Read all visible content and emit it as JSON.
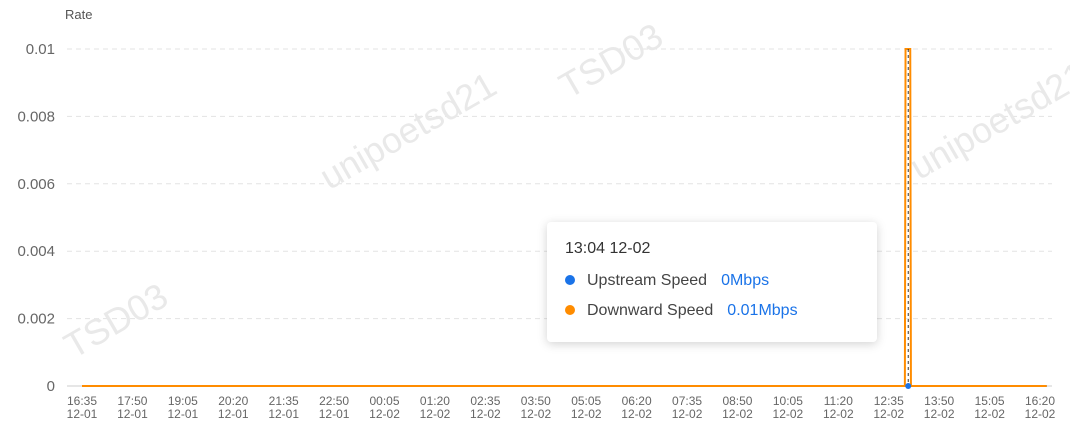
{
  "chart_data": {
    "type": "line",
    "ylabel": "Rate",
    "y_ticks": [
      "0.01",
      "0.008",
      "0.006",
      "0.004",
      "0.002",
      "0"
    ],
    "ylim": [
      0,
      0.01
    ],
    "grid": "horizontal-dashed",
    "x_labels": [
      {
        "time": "16:35",
        "date": "12-01"
      },
      {
        "time": "17:50",
        "date": "12-01"
      },
      {
        "time": "19:05",
        "date": "12-01"
      },
      {
        "time": "20:20",
        "date": "12-01"
      },
      {
        "time": "21:35",
        "date": "12-01"
      },
      {
        "time": "22:50",
        "date": "12-01"
      },
      {
        "time": "00:05",
        "date": "12-02"
      },
      {
        "time": "01:20",
        "date": "12-02"
      },
      {
        "time": "02:35",
        "date": "12-02"
      },
      {
        "time": "03:50",
        "date": "12-02"
      },
      {
        "time": "05:05",
        "date": "12-02"
      },
      {
        "time": "06:20",
        "date": "12-02"
      },
      {
        "time": "07:35",
        "date": "12-02"
      },
      {
        "time": "08:50",
        "date": "12-02"
      },
      {
        "time": "10:05",
        "date": "12-02"
      },
      {
        "time": "11:20",
        "date": "12-02"
      },
      {
        "time": "12:35",
        "date": "12-02"
      },
      {
        "time": "13:50",
        "date": "12-02"
      },
      {
        "time": "15:05",
        "date": "12-02"
      },
      {
        "time": "16:20",
        "date": "12-02"
      }
    ],
    "series": [
      {
        "name": "Upstream Speed",
        "color": "#1a73e8",
        "points": [
          [
            "12-01 16:35",
            0
          ],
          [
            "12-02 16:30",
            0
          ]
        ]
      },
      {
        "name": "Downward Speed",
        "color": "#ff8c00",
        "points": [
          [
            "12-01 16:35",
            0
          ],
          [
            "12-02 12:59",
            0
          ],
          [
            "12-02 13:00",
            0.01
          ],
          [
            "12-02 13:03",
            0.01
          ],
          [
            "12-02 13:04",
            0.01
          ],
          [
            "12-02 13:07",
            0.01
          ],
          [
            "12-02 13:08",
            0
          ],
          [
            "12-02 16:30",
            0
          ]
        ]
      }
    ],
    "cursor_time": "12-02 13:04"
  },
  "tooltip": {
    "time": "13:04 12-02",
    "rows": [
      {
        "label": "Upstream Speed",
        "value": "0Mbps",
        "color": "#1a73e8"
      },
      {
        "label": "Downward Speed",
        "value": "0.01Mbps",
        "color": "#ff8c00"
      }
    ]
  },
  "watermark": {
    "texts": [
      "TSD03",
      "unipoetsd21",
      "TSD03",
      "unipoetsd21",
      "TSD03"
    ]
  }
}
